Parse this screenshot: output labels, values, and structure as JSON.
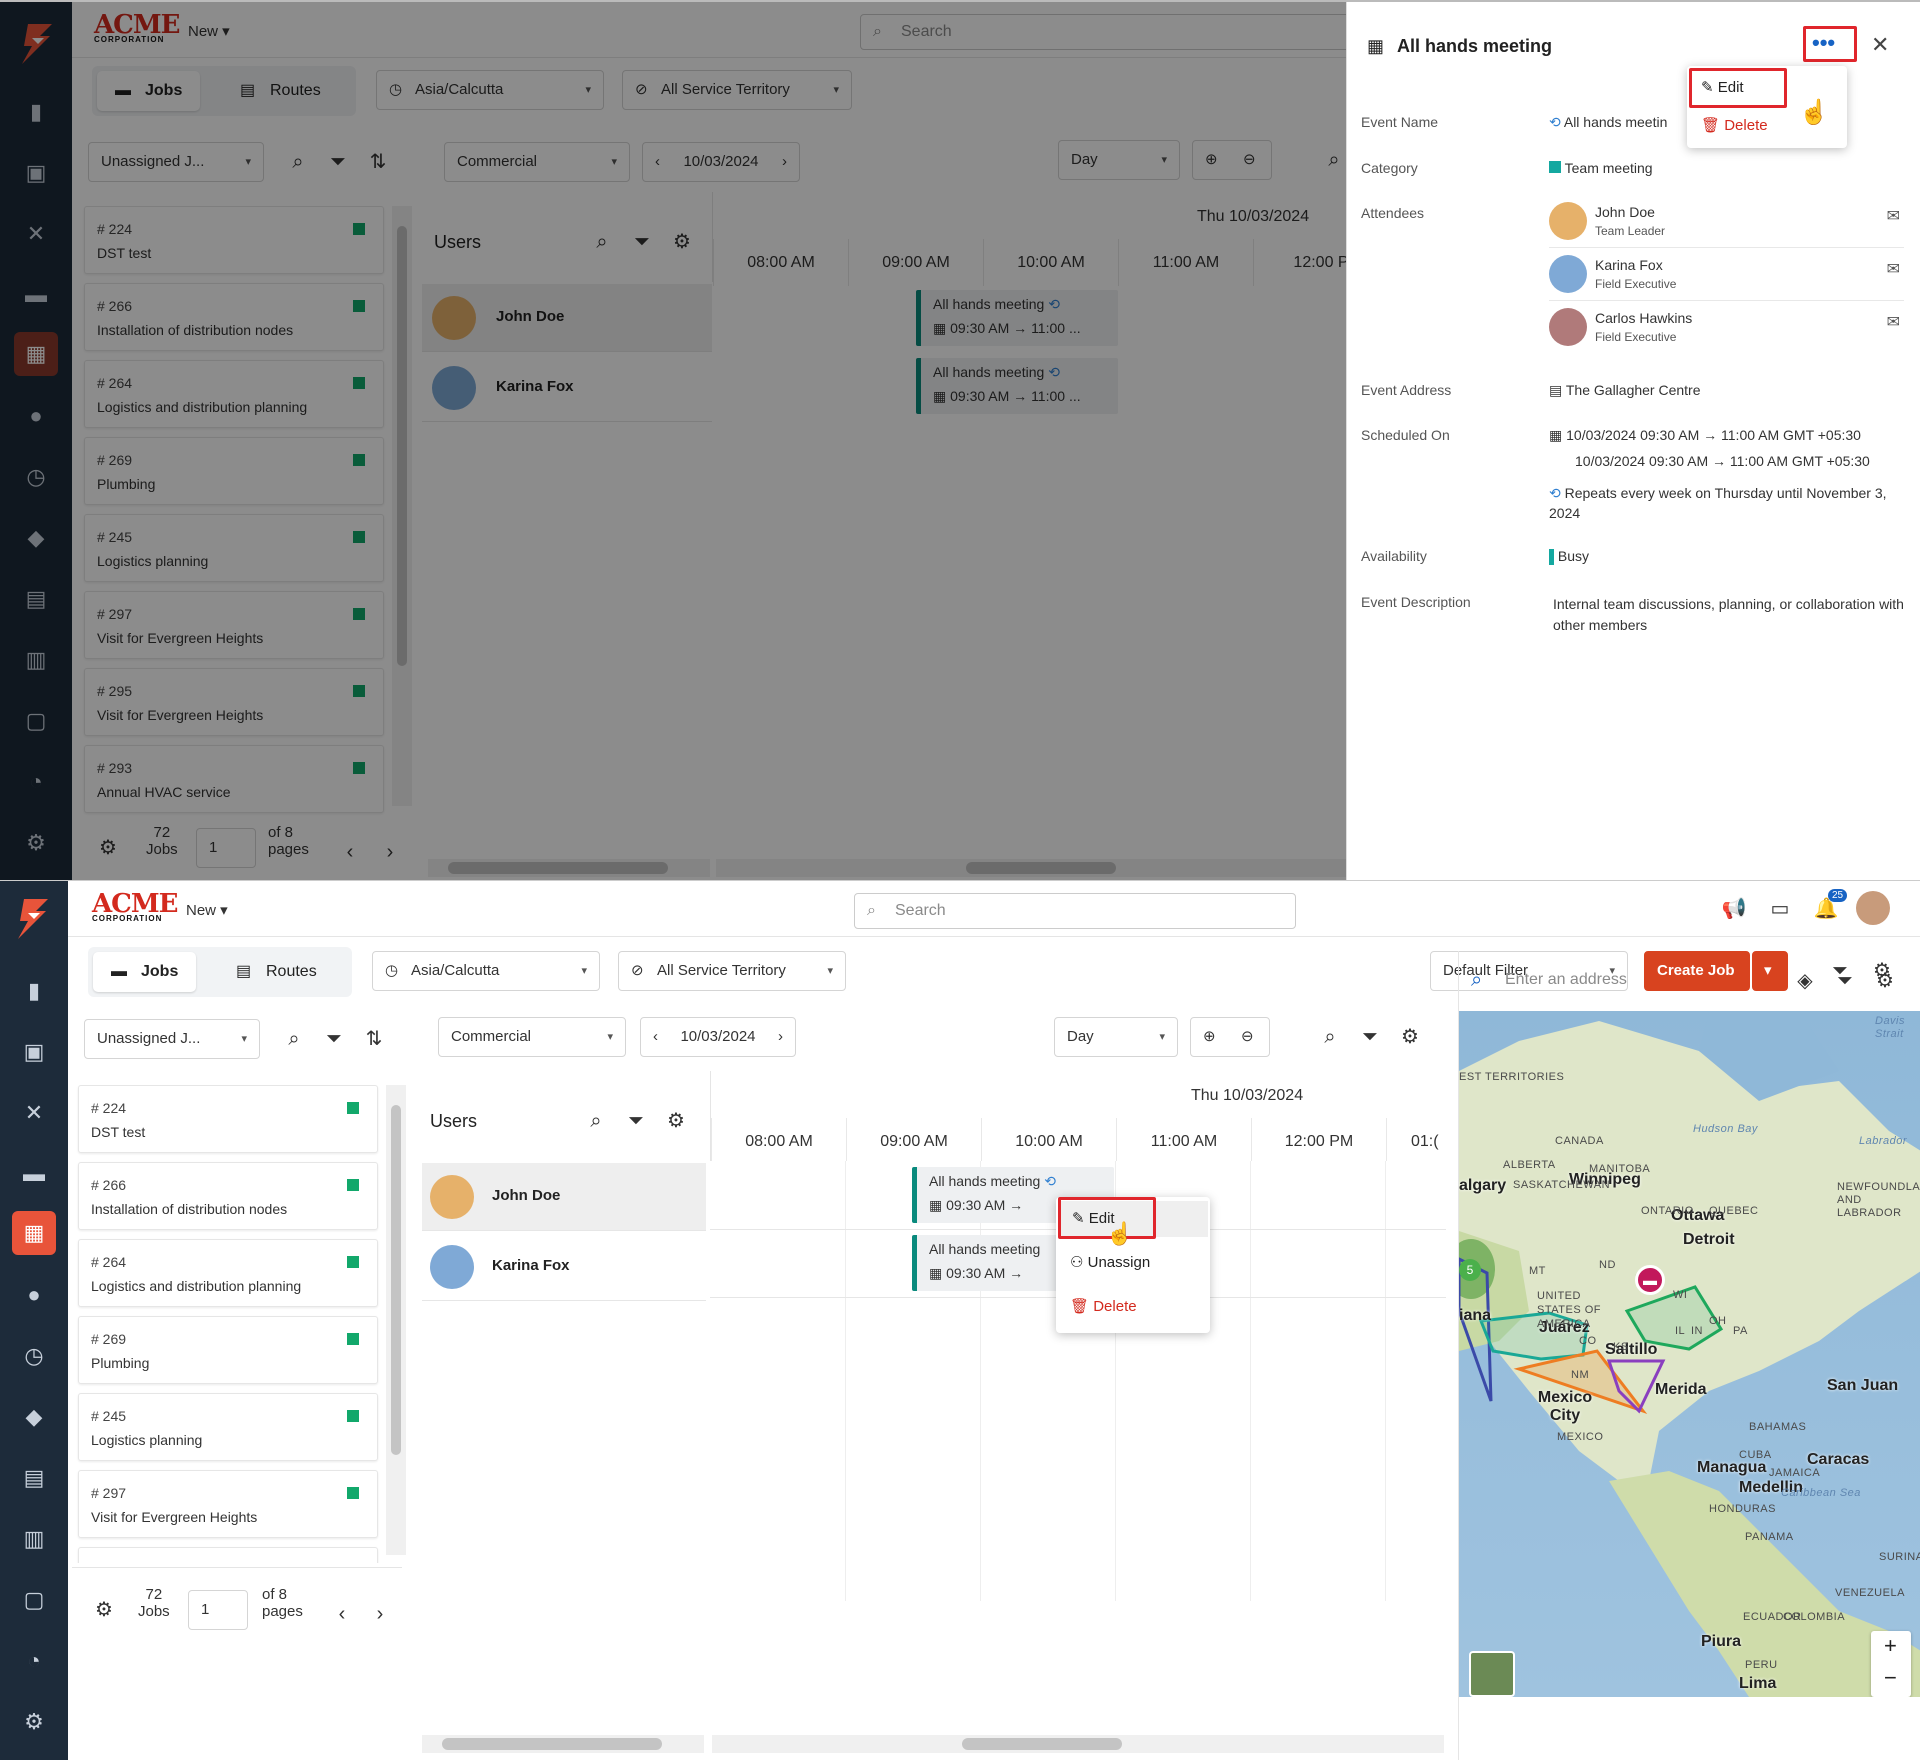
{
  "brand": {
    "name": "ACME",
    "sub": "CORPORATION"
  },
  "topbar": {
    "new_label": "New",
    "search_placeholder": "Search",
    "notif_count": "25"
  },
  "toolbar": {
    "tabs": [
      {
        "label": "Jobs"
      },
      {
        "label": "Routes"
      }
    ],
    "timezone": "Asia/Calcutta",
    "territory": "All Service Territory",
    "default_filter": "Default Filter",
    "create_job": "Create Job"
  },
  "job_list": {
    "filter": "Unassigned J...",
    "jobs": [
      {
        "num": "# 224",
        "title": "DST test"
      },
      {
        "num": "# 266",
        "title": "Installation of distribution nodes"
      },
      {
        "num": "# 264",
        "title": "Logistics and distribution planning"
      },
      {
        "num": "# 269",
        "title": "Plumbing"
      },
      {
        "num": "# 245",
        "title": "Logistics planning"
      },
      {
        "num": "# 297",
        "title": "Visit for Evergreen Heights"
      },
      {
        "num": "# 295",
        "title": "Visit for Evergreen Heights"
      },
      {
        "num": "# 293",
        "title": "Annual HVAC service"
      }
    ],
    "total": "72",
    "total_label": "Jobs",
    "page": "1",
    "of_pages": "of 8",
    "pages_label": "pages"
  },
  "schedule": {
    "category": "Commercial",
    "date": "10/03/2024",
    "view": "Day",
    "day_header": "Thu 10/03/2024",
    "users_label": "Users",
    "hours_top": [
      "08:00 AM",
      "09:00 AM",
      "10:00 AM",
      "11:00 AM",
      "12:00 P"
    ],
    "hours_bottom": [
      "08:00 AM",
      "09:00 AM",
      "10:00 AM",
      "11:00 AM",
      "12:00 PM",
      "01:("
    ],
    "users": [
      {
        "name": "John Doe"
      },
      {
        "name": "Karina Fox"
      }
    ],
    "event": {
      "title": "All hands meeting",
      "time": "09:30 AM",
      "end": "11:00 ..."
    }
  },
  "context_menu": {
    "edit": "Edit",
    "unassign": "Unassign",
    "delete": "Delete"
  },
  "details": {
    "title": "All hands meeting",
    "menu_edit": "Edit",
    "menu_delete": "Delete",
    "event_name_label": "Event Name",
    "event_name": "All hands meetin",
    "category_label": "Category",
    "category": "Team meeting",
    "attendees_label": "Attendees",
    "attendees": [
      {
        "name": "John Doe",
        "role": "Team Leader"
      },
      {
        "name": "Karina Fox",
        "role": "Field Executive"
      },
      {
        "name": "Carlos Hawkins",
        "role": "Field Executive"
      }
    ],
    "address_label": "Event Address",
    "address": "The Gallagher Centre",
    "scheduled_label": "Scheduled On",
    "sched_line1": "10/03/2024 09:30 AM",
    "sched_end1": "11:00 AM GMT +05:30",
    "sched_line2": "10/03/2024 09:30 AM",
    "sched_end2": "11:00 AM GMT +05:30",
    "repeat": "Repeats every week on Thursday until November 3, 2024",
    "availability_label": "Availability",
    "availability": "Busy",
    "description_label": "Event Description",
    "description": "Internal team discussions, planning, or collaboration with other members"
  },
  "map": {
    "address_placeholder": "Enter an address",
    "labels": [
      "Winnipeg",
      "Ottawa",
      "Detroit",
      "Juárez",
      "Saltillo",
      "Mexico City",
      "Merida",
      "San Juan",
      "Managua",
      "Caracas",
      "Medellin",
      "Piura",
      "Lima",
      "algary",
      "iana"
    ],
    "small_labels": [
      "CANADA",
      "ALBERTA",
      "MANITOBA",
      "ONTARIO",
      "QUEBEC",
      "SASKATCHEWAN",
      "Hudson Bay",
      "Labrador",
      "UNITED STATES OF AMERICA",
      "MEXICO",
      "COLOMBIA",
      "VENEZUELA",
      "PERU",
      "ECUADOR",
      "Caribbean Sea",
      "NEWFOUNDLAND AND LABRADOR",
      "EST TERRITORIES",
      "SURINAME",
      "HONDURAS",
      "PANAMA",
      "BAHAMAS",
      "CUBA",
      "JAMAICA",
      "Davis Strait",
      "MT",
      "ND",
      "MN",
      "WI",
      "NM",
      "KS",
      "CO",
      "PA",
      "IL",
      "IN",
      "OH"
    ],
    "cluster": "5",
    "zoom_in": "+",
    "zoom_out": "−"
  }
}
